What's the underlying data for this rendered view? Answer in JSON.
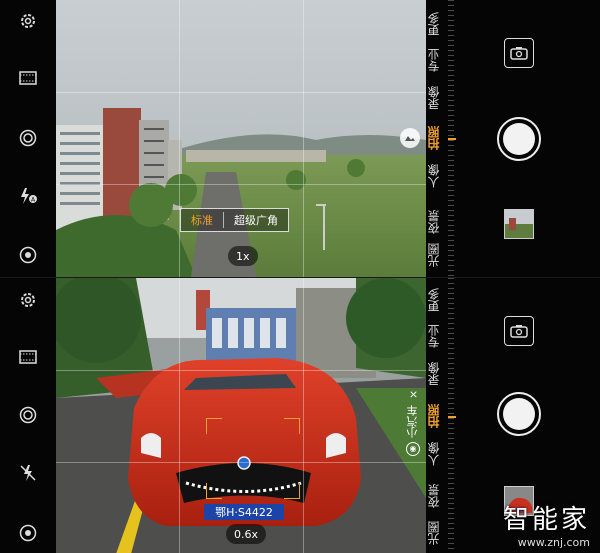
{
  "top_panel": {
    "modes": [
      "光圈",
      "夜景",
      "人像",
      "拍照",
      "录像",
      "专业",
      "更多"
    ],
    "active_mode": "拍照",
    "lens_options": [
      "标准",
      "超级广角"
    ],
    "selected_lens": "标准",
    "zoom": "1x"
  },
  "bottom_panel": {
    "modes": [
      "光圈",
      "夜景",
      "人像",
      "拍照",
      "录像",
      "专业",
      "更多"
    ],
    "active_mode": "拍照",
    "zoom": "0.6x",
    "ai_label": "小汽车",
    "ai_close": "×",
    "plate": "鄂H·S4422"
  },
  "watermark": {
    "brand": "智能家",
    "url": "www.znj.com"
  },
  "colors": {
    "accent": "#f0a030",
    "bar": "#050505"
  },
  "icons": [
    "settings-icon",
    "filmstrip-icon",
    "aperture-icon",
    "flash-auto-icon",
    "flash-off-icon",
    "filter-icon",
    "camera-switch-icon",
    "shutter-button",
    "gallery-thumbnail"
  ]
}
